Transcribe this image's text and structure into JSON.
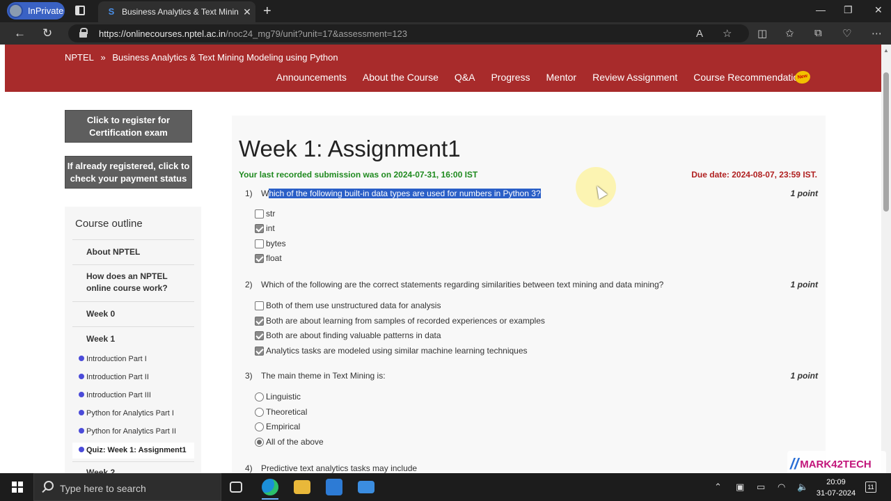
{
  "browser": {
    "inprivate_label": "InPrivate",
    "tab_title": "Business Analytics & Text Mining",
    "url_host": "https://onlinecourses.nptel.ac.in",
    "url_path": "/noc24_mg79/unit?unit=17&assessment=123"
  },
  "header": {
    "breadcrumb_home": "NPTEL",
    "breadcrumb_sep": "»",
    "breadcrumb_course": "Business Analytics & Text Mining Modeling using Python",
    "nav": [
      "Announcements",
      "About the Course",
      "Q&A",
      "Progress",
      "Mentor",
      "Review Assignment",
      "Course Recommendations"
    ],
    "new_badge": "New"
  },
  "sidebar": {
    "register_button": "Click to register for Certification exam",
    "payment_button": "If already registered, click to check your payment status",
    "outline_title": "Course outline",
    "items": [
      "About NPTEL",
      "How does an NPTEL online course work?",
      "Week 0",
      "Week 1"
    ],
    "week1_units": [
      "Introduction Part I",
      "Introduction Part II",
      "Introduction Part III",
      "Python for Analytics Part I",
      "Python for Analytics Part II"
    ],
    "active_item": "Quiz: Week 1: Assignment1",
    "next_item": "Week 2"
  },
  "assignment": {
    "title": "Week 1: Assignment1",
    "last_submission": "Your last recorded submission was on 2024-07-31, 16:00 IST",
    "due_date": "Due date: 2024-08-07, 23:59 IST.",
    "questions": [
      {
        "num": "1)",
        "text_plain": "W",
        "text_highlight": "hich of the following built-in data types are used for numbers in Python 3?",
        "points": "1 point",
        "type": "checkbox",
        "options": [
          {
            "label": "str",
            "checked": false
          },
          {
            "label": "int",
            "checked": true
          },
          {
            "label": "bytes",
            "checked": false
          },
          {
            "label": "float",
            "checked": true
          }
        ]
      },
      {
        "num": "2)",
        "text": "Which of the following are the correct statements regarding similarities between text mining and data mining?",
        "points": "1 point",
        "type": "checkbox",
        "options": [
          {
            "label": "Both of them use unstructured data for analysis",
            "checked": false
          },
          {
            "label": "Both are about learning from samples of recorded experiences or examples",
            "checked": true
          },
          {
            "label": "Both are about finding valuable patterns in data",
            "checked": true
          },
          {
            "label": "Analytics tasks are modeled using similar machine learning techniques",
            "checked": true
          }
        ]
      },
      {
        "num": "3)",
        "text": "The main theme in Text Mining is:",
        "points": "1 point",
        "type": "radio",
        "options": [
          {
            "label": "Linguistic",
            "checked": false
          },
          {
            "label": "Theoretical",
            "checked": false
          },
          {
            "label": "Empirical",
            "checked": false
          },
          {
            "label": "All of the above",
            "checked": true
          }
        ]
      },
      {
        "num": "4)",
        "text": "Predictive text analytics tasks may include"
      }
    ]
  },
  "watermark": {
    "text": "MARK42TECH"
  },
  "taskbar": {
    "search_placeholder": "Type here to search",
    "time": "20:09",
    "date": "31-07-2024",
    "notification_count": "11"
  },
  "colors": {
    "header_red": "#a82b2b",
    "submission_green": "#1f8a1f",
    "due_red": "#b02020",
    "highlight_blue": "#2a5fc7",
    "bullet_blue": "#4b4bd9"
  }
}
